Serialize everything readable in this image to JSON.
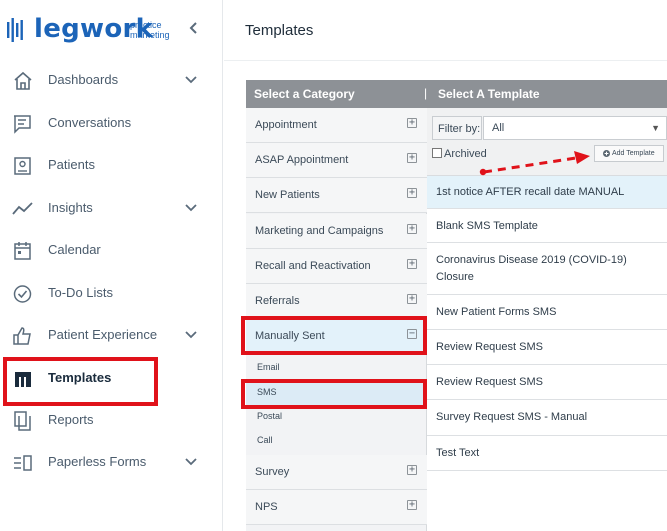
{
  "brand": {
    "name": "legwork",
    "sub_line1": "practice",
    "sub_line2": "marketing",
    "colors": {
      "brand": "#1c64b8",
      "highlight": "#e0121a",
      "selected": "#e3f2fa"
    }
  },
  "sidebar": {
    "collapse_icon": "chevron-left-icon",
    "items": [
      {
        "label": "Dashboards",
        "icon": "home-icon",
        "chevron": true
      },
      {
        "label": "Conversations",
        "icon": "chat-icon",
        "chevron": false
      },
      {
        "label": "Patients",
        "icon": "patient-card-icon",
        "chevron": false
      },
      {
        "label": "Insights",
        "icon": "trend-icon",
        "chevron": true
      },
      {
        "label": "Calendar",
        "icon": "calendar-icon",
        "chevron": false
      },
      {
        "label": "To-Do Lists",
        "icon": "check-circle-icon",
        "chevron": false
      },
      {
        "label": "Patient Experience",
        "icon": "thumbs-up-icon",
        "chevron": true
      },
      {
        "label": "Templates",
        "icon": "templates-icon",
        "chevron": false,
        "active": true
      },
      {
        "label": "Reports",
        "icon": "reports-icon",
        "chevron": false
      },
      {
        "label": "Paperless Forms",
        "icon": "forms-icon",
        "chevron": true
      }
    ]
  },
  "main": {
    "title": "Templates",
    "category_header": "Select a Category",
    "separator": "|",
    "template_header": "Select A Template",
    "categories": [
      {
        "label": "Appointment",
        "toggle": "+"
      },
      {
        "label": "ASAP Appointment",
        "toggle": "+"
      },
      {
        "label": "New Patients",
        "toggle": "+"
      },
      {
        "label": "Marketing and Campaigns",
        "toggle": "+"
      },
      {
        "label": "Recall and Reactivation",
        "toggle": "+"
      },
      {
        "label": "Referrals",
        "toggle": "+"
      },
      {
        "label": "Manually Sent",
        "toggle": "−",
        "active": true
      },
      {
        "label": "Survey",
        "toggle": "+"
      },
      {
        "label": "NPS",
        "toggle": "+"
      }
    ],
    "subcategories": [
      {
        "label": "Email"
      },
      {
        "label": "SMS",
        "active": true
      },
      {
        "label": "Postal"
      },
      {
        "label": "Call"
      }
    ],
    "filter": {
      "label": "Filter by:",
      "value": "All",
      "caret": "▼"
    },
    "archived_label": "Archived",
    "add_template_label": "Add Template",
    "templates": [
      {
        "label": "1st notice AFTER recall date MANUAL",
        "active": true
      },
      {
        "label": "Blank SMS Template"
      },
      {
        "label": "Coronavirus Disease 2019 (COVID-19) Closure"
      },
      {
        "label": "New Patient Forms SMS"
      },
      {
        "label": "Review Request SMS"
      },
      {
        "label": "Review Request SMS"
      },
      {
        "label": "Survey Request SMS - Manual"
      },
      {
        "label": "Test Text"
      }
    ]
  }
}
